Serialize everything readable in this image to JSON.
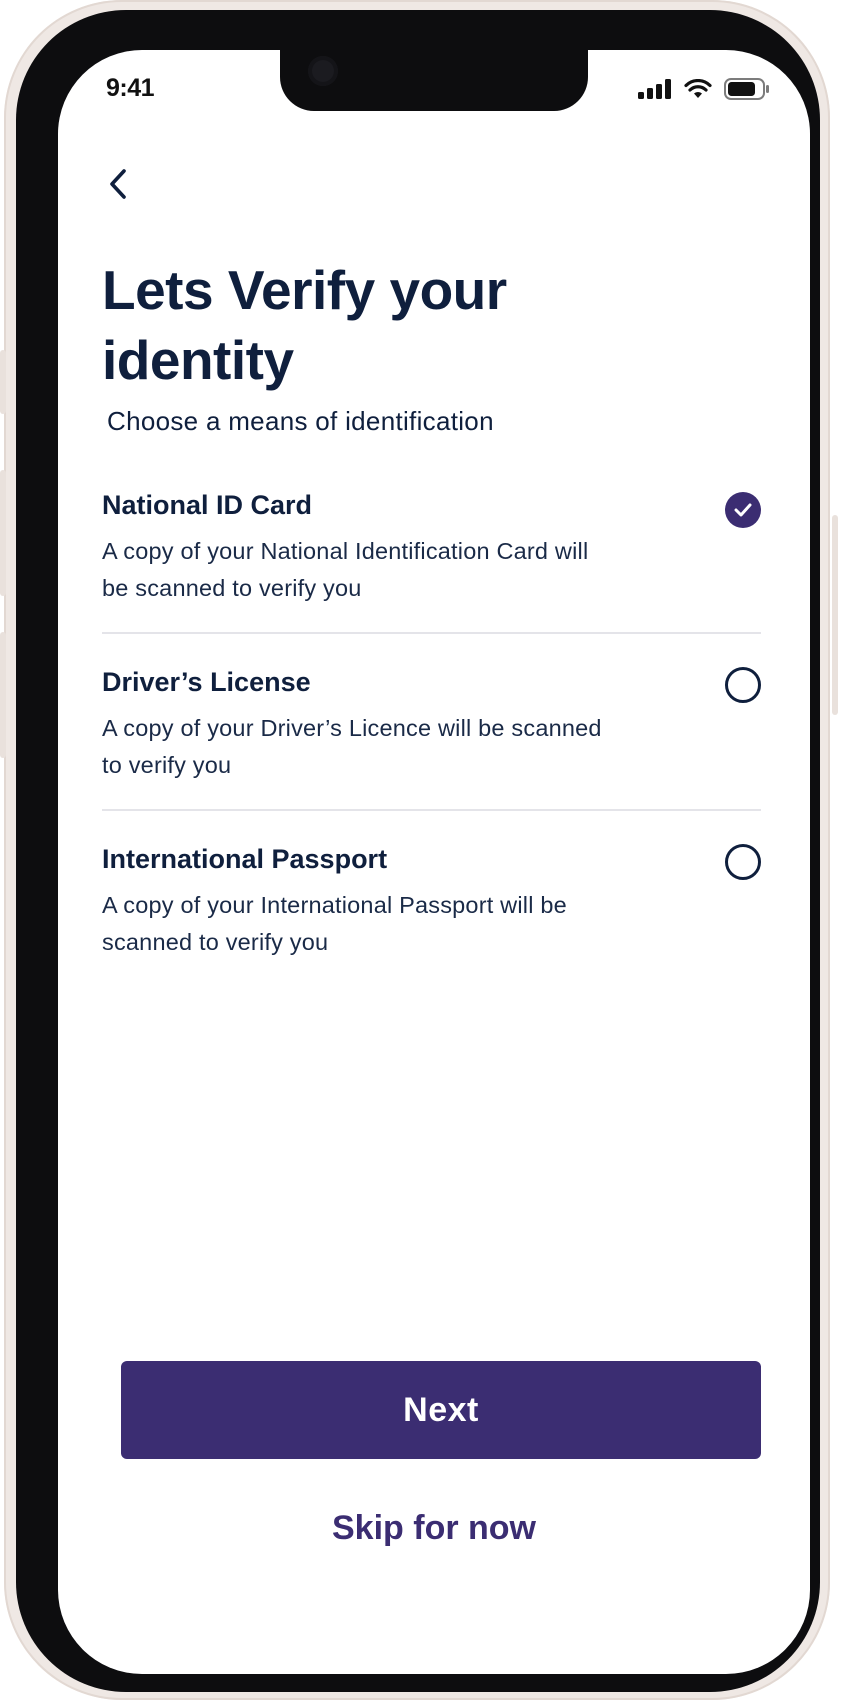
{
  "status_bar": {
    "time": "9:41",
    "icons": [
      "signal-icon",
      "wifi-icon",
      "battery-icon"
    ]
  },
  "header": {
    "back_icon": "chevron-left-icon",
    "title": "Lets Verify your identity",
    "subtitle": "Choose a means of identification"
  },
  "options": [
    {
      "title": "National ID Card",
      "description": "A copy of your National Identification Card will be scanned to verify you",
      "selected": true
    },
    {
      "title": "Driver’s License",
      "description": "A copy of your Driver’s Licence will be scanned to verify you",
      "selected": false
    },
    {
      "title": "International Passport",
      "description": "A copy of your International Passport will be scanned to verify you",
      "selected": false
    }
  ],
  "actions": {
    "next_label": "Next",
    "skip_label": "Skip for now"
  },
  "colors": {
    "primary": "#3b2d72",
    "text": "#0f1f3d",
    "divider": "#e4e4e9"
  }
}
